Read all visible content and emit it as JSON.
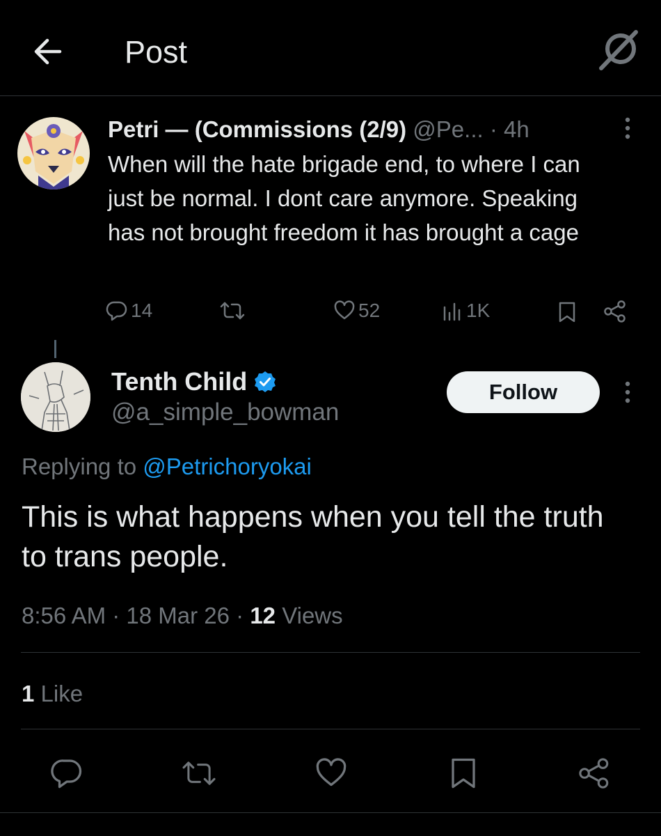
{
  "header": {
    "title": "Post",
    "back_icon": "arrow-left-icon",
    "grok_icon": "grok-icon"
  },
  "parent_tweet": {
    "display_name": "Petri — (Commissions (2/9)",
    "handle": "@Pe...",
    "time": "· 4h",
    "text": "When will the hate brigade end, to where I can just be normal. I dont care anymore. Speaking has not brought freedom it has brought a cage",
    "stats": {
      "replies": "14",
      "likes": "52",
      "views": "1K"
    }
  },
  "reply_tweet": {
    "display_name": "Tenth Child",
    "verified": true,
    "handle": "@a_simple_bowman",
    "follow_label": "Follow",
    "replying_prefix": "Replying to",
    "replying_to": "@Petrichoryokai",
    "text": "This is what happens when you tell the truth to trans people.",
    "timestamp": "8:56 AM · 18 Mar 26 · ",
    "views_count": "12",
    "views_label": " Views",
    "likes_count": "1",
    "likes_label": " Like"
  },
  "colors": {
    "background": "#000000",
    "text": "#e7e9ea",
    "muted": "#71767b",
    "accent": "#1d9bf0",
    "divider": "#2f3336"
  }
}
